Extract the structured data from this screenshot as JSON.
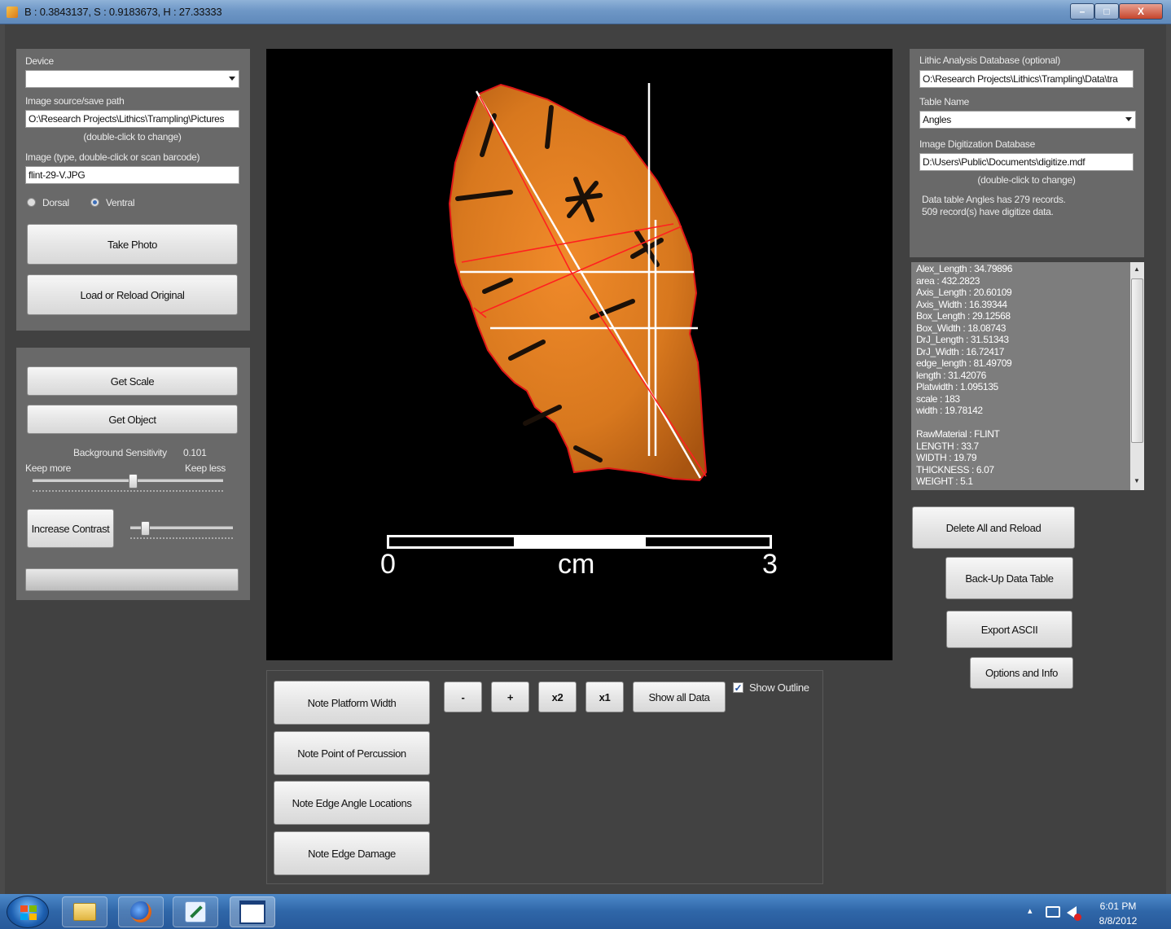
{
  "window": {
    "title": "B : 0.3843137, S : 0.9183673, H : 27.33333",
    "minimize_label": "–",
    "maximize_label": "□",
    "close_label": "X"
  },
  "left_top": {
    "device_label": "Device",
    "device_value": "",
    "path_label": "Image source/save path",
    "path_value": "O:\\Research Projects\\Lithics\\Trampling\\Pictures",
    "path_hint": "(double-click to change)",
    "image_label": "Image (type, double-click or scan barcode)",
    "image_value": "flint-29-V.JPG",
    "radio_dorsal": "Dorsal",
    "radio_ventral": "Ventral",
    "take_photo": "Take Photo",
    "load_reload": "Load or Reload Original"
  },
  "left_bottom": {
    "get_scale": "Get Scale",
    "get_object": "Get Object",
    "bg_sensitivity_label": "Background Sensitivity",
    "bg_sensitivity_value": "0.101",
    "keep_more": "Keep more",
    "keep_less": "Keep less",
    "increase_contrast": "Increase Contrast",
    "sensitivity_level": 0.52,
    "contrast_level": 0.1
  },
  "scale_bar": {
    "min_label": "0",
    "unit_label": "cm",
    "max_label": "3"
  },
  "bottom_tools": {
    "note_platform_width": "Note Platform Width",
    "note_point_percussion": "Note Point of Percussion",
    "note_edge_angle": "Note Edge Angle Locations",
    "note_edge_damage": "Note Edge Damage",
    "zoom_minus": "-",
    "zoom_plus": "+",
    "zoom_x2": "x2",
    "zoom_x1": "x1",
    "show_all_data": "Show all Data",
    "show_outline": "Show Outline",
    "show_outline_checked": true
  },
  "right_top": {
    "lithic_db_label": "Lithic Analysis Database (optional)",
    "lithic_db_value": "O:\\Research Projects\\Lithics\\Trampling\\Data\\tra",
    "table_name_label": "Table Name",
    "table_name_value": "Angles",
    "image_db_label": "Image Digitization Database",
    "image_db_value": "D:\\Users\\Public\\Documents\\digitize.mdf",
    "image_db_hint": "(double-click to change)",
    "info_line1": "Data table Angles has 279 records.",
    "info_line2": "509 record(s) have digitize data."
  },
  "data_lines": [
    "Alex_Length : 34.79896",
    "area : 432.2823",
    "Axis_Length : 20.60109",
    "Axis_Width : 16.39344",
    "Box_Length : 29.12568",
    "Box_Width : 18.08743",
    "DrJ_Length : 31.51343",
    "DrJ_Width : 16.72417",
    "edge_length : 81.49709",
    "length : 31.42076",
    "Platwidth : 1.095135",
    "scale : 183",
    "width : 19.78142",
    "",
    "RawMaterial : FLINT",
    "LENGTH : 33.7",
    "WIDTH : 19.79",
    "THICKNESS : 6.07",
    "WEIGHT : 5.1"
  ],
  "right_buttons": {
    "delete_reload": "Delete All and Reload",
    "backup": "Back-Up Data Table",
    "export_ascii": "Export ASCII",
    "options_info": "Options and Info"
  },
  "taskbar": {
    "time": "6:01 PM",
    "date": "8/8/2012",
    "tray_up": "▴"
  },
  "colors": {
    "outline": "#e01818",
    "guides": "#ffffff",
    "artifact": "#d8781e",
    "taskbar": "#2f66a8"
  }
}
